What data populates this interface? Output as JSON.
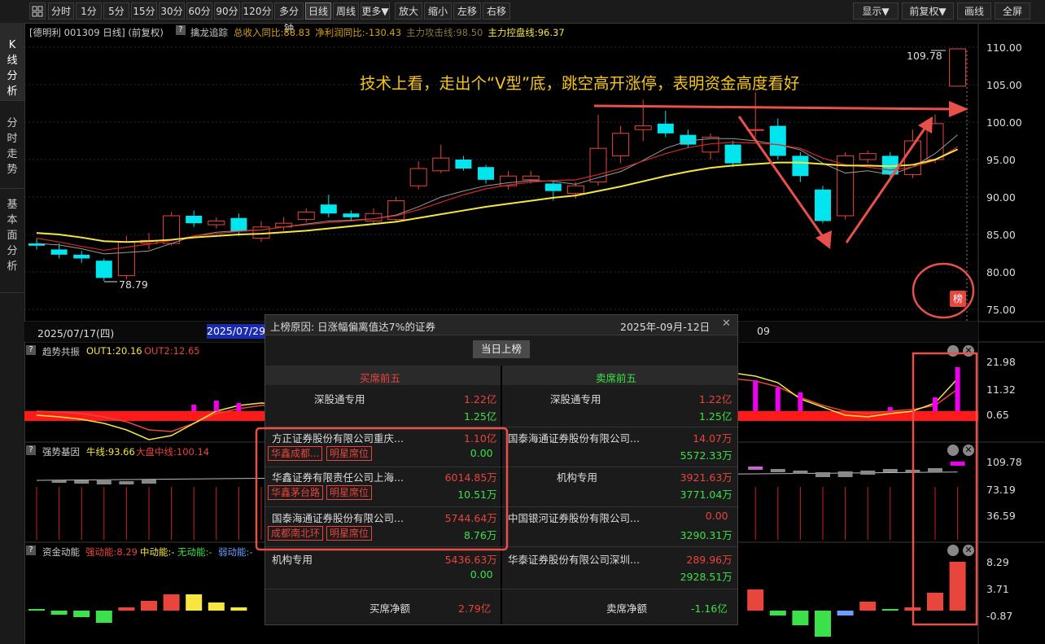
{
  "toolbar": {
    "grid_icon": "grid-icon",
    "period_buttons": [
      "分时",
      "1分",
      "5分",
      "15分",
      "30分",
      "60分",
      "90分",
      "120分",
      "多分钟",
      "日线",
      "周线",
      "更多▼"
    ],
    "active_period": "日线",
    "action_buttons": [
      "放大",
      "缩小",
      "左移",
      "右移"
    ],
    "right_buttons": [
      "显示▼",
      "前复权▼",
      "画线",
      "全屏"
    ]
  },
  "left_tabs": [
    {
      "label": "K线分析",
      "active": true
    },
    {
      "label": "分时走势",
      "active": false
    },
    {
      "label": "基本面分析",
      "active": false
    }
  ],
  "main_chart": {
    "title": "[德明利 001309 日线]  (前复权)",
    "help_icon": "?",
    "indicator_name": "擒龙追踪",
    "metrics": [
      {
        "text": "总收入同比:88.83",
        "color": "#d4a017"
      },
      {
        "text": "净利润同比:-130.43",
        "color": "#d4a017"
      },
      {
        "text": "主力攻击线:98.50",
        "color": "#8a7a3a"
      },
      {
        "text": "主力控盘线:96.37",
        "color": "#f5e642"
      }
    ],
    "annotation": "技术上看，走出个“V型”底，跳空高开涨停，表明资金高度看好",
    "price_axis": [
      "110.00",
      "105.00",
      "100.00",
      "95.00",
      "90.00",
      "85.00",
      "80.00",
      "75.00"
    ],
    "high_label": "109.78",
    "low_label": "78.79",
    "badge": "榜",
    "dates": {
      "d1": "2025/07/17(四)",
      "d2": "2025/07/29",
      "d3": "09"
    }
  },
  "chart_data": {
    "type": "candlestick",
    "y_range": [
      75,
      110
    ],
    "candles": [
      {
        "o": 83.8,
        "c": 83.5,
        "h": 84.5,
        "l": 83.0
      },
      {
        "o": 83.0,
        "c": 82.3,
        "h": 83.8,
        "l": 81.8
      },
      {
        "o": 82.3,
        "c": 81.8,
        "h": 82.8,
        "l": 81.2
      },
      {
        "o": 81.5,
        "c": 79.2,
        "h": 81.8,
        "l": 78.79
      },
      {
        "o": 79.5,
        "c": 84.0,
        "h": 84.8,
        "l": 79.0
      },
      {
        "o": 83.8,
        "c": 84.2,
        "h": 85.2,
        "l": 83.0
      },
      {
        "o": 83.8,
        "c": 87.5,
        "h": 88.0,
        "l": 83.5
      },
      {
        "o": 87.5,
        "c": 86.5,
        "h": 88.2,
        "l": 86.0
      },
      {
        "o": 86.3,
        "c": 86.8,
        "h": 87.3,
        "l": 85.8
      },
      {
        "o": 87.2,
        "c": 85.4,
        "h": 87.8,
        "l": 84.8
      },
      {
        "o": 84.5,
        "c": 86.0,
        "h": 86.8,
        "l": 84.0
      },
      {
        "o": 86.0,
        "c": 86.5,
        "h": 87.3,
        "l": 85.5
      },
      {
        "o": 87.0,
        "c": 88.0,
        "h": 88.5,
        "l": 86.6
      },
      {
        "o": 89.0,
        "c": 87.8,
        "h": 90.3,
        "l": 87.3
      },
      {
        "o": 87.8,
        "c": 87.3,
        "h": 88.2,
        "l": 86.8
      },
      {
        "o": 86.8,
        "c": 87.8,
        "h": 88.5,
        "l": 86.5
      },
      {
        "o": 87.0,
        "c": 89.5,
        "h": 90.0,
        "l": 86.8
      },
      {
        "o": 91.5,
        "c": 93.8,
        "h": 94.8,
        "l": 91.0
      },
      {
        "o": 93.5,
        "c": 95.2,
        "h": 97.0,
        "l": 93.2
      },
      {
        "o": 95.0,
        "c": 93.8,
        "h": 95.5,
        "l": 93.5
      },
      {
        "o": 94.0,
        "c": 92.3,
        "h": 94.3,
        "l": 91.8
      },
      {
        "o": 91.5,
        "c": 92.8,
        "h": 93.5,
        "l": 91.0
      },
      {
        "o": 92.3,
        "c": 92.8,
        "h": 93.5,
        "l": 91.8
      },
      {
        "o": 91.8,
        "c": 90.8,
        "h": 92.2,
        "l": 89.5
      },
      {
        "o": 90.5,
        "c": 91.5,
        "h": 92.0,
        "l": 89.8
      },
      {
        "o": 92.0,
        "c": 96.5,
        "h": 101.0,
        "l": 91.5
      },
      {
        "o": 95.5,
        "c": 98.5,
        "h": 99.5,
        "l": 94.5
      },
      {
        "o": 99.0,
        "c": 99.5,
        "h": 103.0,
        "l": 97.5
      },
      {
        "o": 99.8,
        "c": 98.5,
        "h": 101.5,
        "l": 98.0
      },
      {
        "o": 98.3,
        "c": 97.0,
        "h": 99.0,
        "l": 96.5
      },
      {
        "o": 96.0,
        "c": 98.0,
        "h": 98.5,
        "l": 95.0
      },
      {
        "o": 97.0,
        "c": 94.5,
        "h": 97.5,
        "l": 94.0
      },
      {
        "o": 99.0,
        "c": 99.0,
        "h": 104.0,
        "l": 98.0
      },
      {
        "o": 99.5,
        "c": 95.5,
        "h": 100.5,
        "l": 95.0
      },
      {
        "o": 95.5,
        "c": 92.8,
        "h": 96.0,
        "l": 92.0
      },
      {
        "o": 91.0,
        "c": 86.8,
        "h": 91.5,
        "l": 86.5
      },
      {
        "o": 87.5,
        "c": 95.5,
        "h": 96.0,
        "l": 87.0
      },
      {
        "o": 95.0,
        "c": 95.8,
        "h": 96.2,
        "l": 94.5
      },
      {
        "o": 95.5,
        "c": 93.0,
        "h": 96.0,
        "l": 92.5
      },
      {
        "o": 93.0,
        "c": 97.5,
        "h": 99.0,
        "l": 92.5
      },
      {
        "o": 95.0,
        "c": 99.8,
        "h": 101.0,
        "l": 94.5
      },
      {
        "o": 104.8,
        "c": 109.78,
        "h": 109.78,
        "l": 104.8
      }
    ],
    "ma_gray": [
      83.8,
      83.6,
      83.1,
      82.4,
      82.6,
      82.8,
      83.8,
      84.8,
      85.3,
      85.5,
      85.6,
      86.0,
      86.4,
      86.8,
      86.9,
      87.1,
      87.6,
      88.7,
      90.0,
      90.8,
      91.5,
      91.9,
      92.2,
      92.1,
      91.7,
      92.6,
      93.4,
      94.9,
      96.5,
      97.5,
      97.8,
      97.8,
      97.5,
      97.0,
      96.3,
      94.5,
      93.2,
      93.5,
      93.0,
      94.0,
      95.8,
      98.3
    ],
    "ma_red": [
      84.5,
      84.0,
      83.4,
      82.9,
      83.3,
      83.7,
      84.2,
      84.8,
      85.1,
      85.4,
      85.6,
      86.0,
      86.3,
      86.6,
      86.8,
      87.1,
      87.5,
      88.3,
      89.3,
      90.3,
      91.1,
      91.6,
      92.0,
      92.2,
      92.3,
      93.0,
      93.8,
      94.8,
      95.8,
      96.6,
      97.1,
      97.3,
      97.2,
      97.0,
      96.5,
      95.2,
      94.3,
      94.0,
      93.6,
      94.0,
      94.9,
      96.7
    ],
    "ma_yellow": [
      85.2,
      85.0,
      84.6,
      84.1,
      84.0,
      84.1,
      84.3,
      84.6,
      84.8,
      85.0,
      85.1,
      85.3,
      85.5,
      85.8,
      86.1,
      86.4,
      86.7,
      87.2,
      87.7,
      88.2,
      88.7,
      89.1,
      89.5,
      89.9,
      90.2,
      90.8,
      91.4,
      92.1,
      92.8,
      93.4,
      93.9,
      94.2,
      94.4,
      94.6,
      94.6,
      94.4,
      94.2,
      94.2,
      94.1,
      94.3,
      95.0,
      96.37
    ]
  },
  "panels": {
    "trend": {
      "name": "趋势共振",
      "v1": "OUT1:20.16",
      "v2": "OUT2:12.65",
      "axis": [
        "21.98",
        "11.32",
        "0.65"
      ]
    },
    "gene": {
      "name": "强势基因",
      "v1": "牛线:93.66",
      "v2": "大盘中线:100.14",
      "axis": [
        "109.78",
        "73.19",
        "36.59"
      ]
    },
    "fund": {
      "name": "资金动能",
      "v1": "强动能:8.29",
      "v2": "中动能:-",
      "v3": "无动能:-",
      "v4": "弱动能:-",
      "axis": [
        "8.29",
        "3.71",
        "-0.87"
      ]
    }
  },
  "popup": {
    "title": "上榜原因: 日涨幅偏离值达7%的证券",
    "date": "2025年-09月-12日",
    "close": "✕",
    "tab_button": "当日上榜",
    "buy_header": "买席前五",
    "sell_header": "卖席前五",
    "buy_rows": [
      {
        "name": "深股通专用",
        "buy": "1.22亿",
        "sell": "1.25亿",
        "tags": []
      },
      {
        "name": "方正证券股份有限公司重庆...",
        "buy": "1.10亿",
        "sell": "0.00",
        "tags": [
          "华鑫成都...",
          "明星席位"
        ]
      },
      {
        "name": "华鑫证券有限责任公司上海...",
        "buy": "6014.85万",
        "sell": "10.51万",
        "tags": [
          "华鑫茅台路",
          "明星席位"
        ]
      },
      {
        "name": "国泰海通证券股份有限公司...",
        "buy": "5744.64万",
        "sell": "8.76万",
        "tags": [
          "成都南北环",
          "明星席位"
        ]
      },
      {
        "name": "机构专用",
        "buy": "5436.63万",
        "sell": "0.00",
        "tags": []
      }
    ],
    "sell_rows": [
      {
        "name": "深股通专用",
        "buy": "1.22亿",
        "sell": "1.25亿"
      },
      {
        "name": "国泰海通证券股份有限公司...",
        "buy": "14.07万",
        "sell": "5572.33万"
      },
      {
        "name": "机构专用",
        "buy": "3921.63万",
        "sell": "3771.04万"
      },
      {
        "name": "中国银河证券股份有限公司...",
        "buy": "0.00",
        "sell": "3290.31万"
      },
      {
        "name": "华泰证券股份有限公司深圳...",
        "buy": "289.96万",
        "sell": "2928.51万"
      }
    ],
    "buy_net_label": "买席净额",
    "buy_net": "2.79亿",
    "sell_net_label": "卖席净额",
    "sell_net": "-1.16亿"
  },
  "colors": {
    "up": "#e8453c",
    "down": "#00e5ee",
    "ma_yellow": "#f5e642",
    "annot": "#f5c518",
    "highlight": "#e8504a",
    "magenta": "#ee00ee"
  }
}
